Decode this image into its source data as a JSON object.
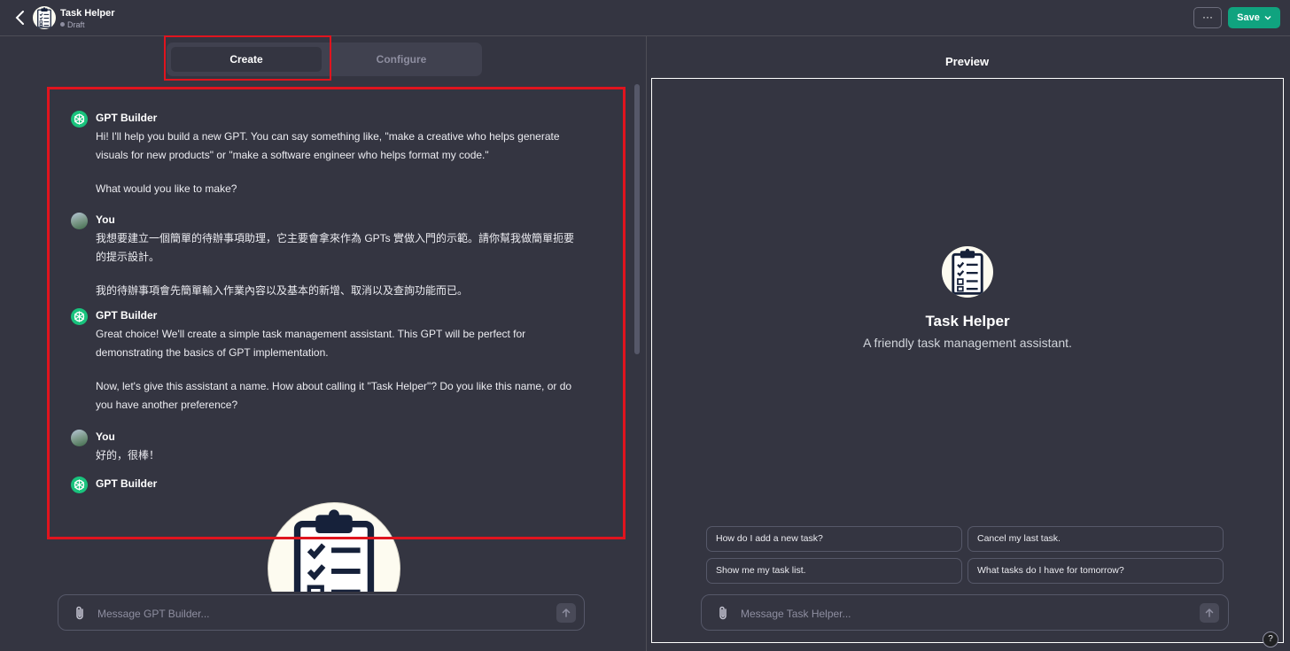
{
  "header": {
    "gpt_name": "Task Helper",
    "status": "Draft",
    "more_label": "···",
    "save_label": "Save"
  },
  "tabs": [
    {
      "label": "Create",
      "active": true
    },
    {
      "label": "Configure",
      "active": false
    }
  ],
  "conversation": [
    {
      "sender": "GPT Builder",
      "paragraphs": [
        "Hi! I'll help you build a new GPT. You can say something like, \"make a creative who helps generate visuals for new products\" or \"make a software engineer who helps format my code.\"",
        "What would you like to make?"
      ]
    },
    {
      "sender": "You",
      "paragraphs": [
        "我想要建立一個簡單的待辦事項助理，它主要會拿來作為 GPTs 實做入門的示範。請你幫我做簡單扼要的提示設計。",
        "我的待辦事項會先簡單輸入作業內容以及基本的新增、取消以及查詢功能而已。"
      ]
    },
    {
      "sender": "GPT Builder",
      "paragraphs": [
        "Great choice! We'll create a simple task management assistant. This GPT will be perfect for demonstrating the basics of GPT implementation.",
        "Now, let's give this assistant a name. How about calling it \"Task Helper\"? Do you like this name, or do you have another preference?"
      ]
    },
    {
      "sender": "You",
      "paragraphs": [
        "好的，很棒！"
      ]
    },
    {
      "sender": "GPT Builder",
      "paragraphs": []
    }
  ],
  "builder_composer": {
    "placeholder": "Message GPT Builder..."
  },
  "preview": {
    "title": "Preview",
    "gpt_name": "Task Helper",
    "description": "A friendly task management assistant.",
    "starters": [
      "How do I add a new task?",
      "Cancel my last task.",
      "Show me my task list.",
      "What tasks do I have for tomorrow?"
    ],
    "composer_placeholder": "Message Task Helper..."
  },
  "help_label": "?",
  "colors": {
    "accent": "#10a37f",
    "highlight": "#e0141e",
    "background": "#343541"
  }
}
